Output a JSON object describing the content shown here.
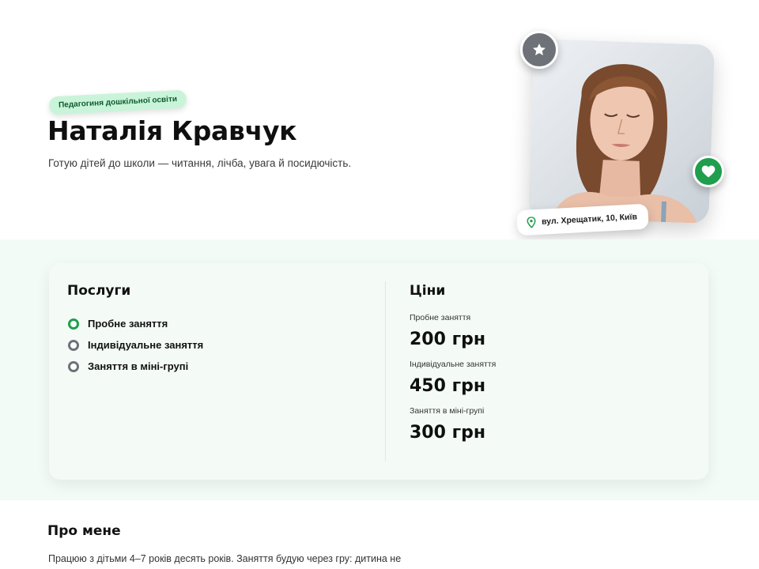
{
  "profile": {
    "tag": "Педагогиня дошкільної освіти",
    "name": "Наталія Кравчук",
    "subtitle": "Готую дітей до школи — читання, лічба, увага й посидючість.",
    "address": "вул. Хрещатик, 10, Київ"
  },
  "icons": {
    "badge_top": "star-icon",
    "badge_side": "heart-icon",
    "address": "map-pin-icon"
  },
  "colors": {
    "accent": "#1f9e4d",
    "tag_bg": "#c9f4d9",
    "band_bg": "#f2fbf5",
    "badge_grey": "#6e7278"
  },
  "services": {
    "title": "Послуги",
    "items": [
      {
        "label": "Пробне заняття",
        "active": true
      },
      {
        "label": "Індивідуальне заняття",
        "active": false
      },
      {
        "label": "Заняття в міні-групі",
        "active": false
      }
    ]
  },
  "prices": {
    "title": "Ціни",
    "items": [
      {
        "label": "Пробне заняття",
        "value": "200 грн"
      },
      {
        "label": "Індивідуальне заняття",
        "value": "450 грн"
      },
      {
        "label": "Заняття в міні-групі",
        "value": "300 грн"
      }
    ]
  },
  "about": {
    "title": "Про мене",
    "text": "Працюю з дітьми 4–7 років десять років. Заняття будую через гру: дитина не"
  }
}
